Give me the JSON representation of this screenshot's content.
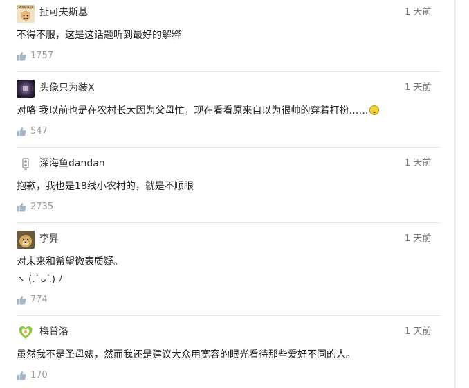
{
  "comments": [
    {
      "username": "扯可夫斯基",
      "time": "1 天前",
      "text": "不得不服，这是这话题听到最好的解释",
      "likes": "1757",
      "avatar_icon": "wanted-poster-avatar-icon"
    },
    {
      "username": "头像只为装X",
      "time": "1 天前",
      "text": "对咯  我以前也是在农村长大因为父母忙，现在看看原来自以为很帅的穿着打扮……",
      "likes": "547",
      "avatar_icon": "dark-purple-avatar-icon",
      "trailing_icon": "laughing-emoji-icon"
    },
    {
      "username": "深海鱼dandan",
      "time": "1 天前",
      "text": "抱歉，我也是18线小农村的，就是不顺眼",
      "likes": "2735",
      "avatar_icon": "default-figure-avatar-icon"
    },
    {
      "username": "李昇",
      "time": "1 天前",
      "text": "对未来和希望微表质疑。",
      "text2": "ヽ (.  ͘ ᴗ  ͘.) ﾉ",
      "likes": "774",
      "avatar_icon": "dog-photo-avatar-icon"
    },
    {
      "username": "梅普洛",
      "time": "1 天前",
      "text": "虽然我不是圣母婊，然而我还是建议大众用宽容的眼光看待那些爱好不同的人。",
      "likes": "170",
      "avatar_icon": "green-heart-badge-avatar-icon"
    }
  ],
  "colors": {
    "text": "#222222",
    "meta": "#7a7a7a",
    "like_icon": "#a5b4c4",
    "divider": "#e8e8e8"
  }
}
